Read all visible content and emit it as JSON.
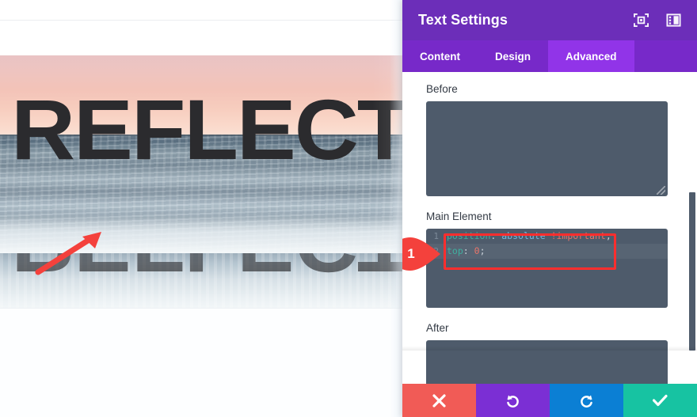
{
  "preview": {
    "hero_title": "REFLECTIO",
    "reflection_title": "REFLECTIO",
    "annotation_arrow": "red-arrow-pointing-at-reflection"
  },
  "modal": {
    "title": "Text Settings",
    "header_icons": [
      {
        "name": "focus-mode-icon",
        "glyph": "target-frame"
      },
      {
        "name": "layout-panel-icon",
        "glyph": "panel-columns"
      }
    ],
    "tabs": [
      {
        "label": "Content",
        "active": false
      },
      {
        "label": "Design",
        "active": false
      },
      {
        "label": "Advanced",
        "active": true
      }
    ],
    "fields": {
      "before": {
        "label": "Before",
        "value": "",
        "placeholder": ""
      },
      "main_element": {
        "label": "Main Element"
      },
      "after": {
        "label": "After",
        "value": "",
        "placeholder": ""
      }
    },
    "code_editor": {
      "lines": [
        {
          "number": "1",
          "tokens": [
            {
              "text": "position",
              "type": "prop"
            },
            {
              "text": ": ",
              "type": "punc"
            },
            {
              "text": "absolute",
              "type": "val"
            },
            {
              "text": " ",
              "type": "punc"
            },
            {
              "text": "!important",
              "type": "imp"
            },
            {
              "text": ";",
              "type": "punc"
            }
          ],
          "plain": "position: absolute !important;",
          "active": false
        },
        {
          "number": "2",
          "tokens": [
            {
              "text": "top",
              "type": "prop"
            },
            {
              "text": ": ",
              "type": "punc"
            },
            {
              "text": "0",
              "type": "num"
            },
            {
              "text": ";",
              "type": "punc"
            }
          ],
          "plain": "top: 0;",
          "active": true
        }
      ]
    },
    "callout": {
      "number": "1"
    },
    "footer_buttons": [
      {
        "name": "cancel-button",
        "icon": "close-x-icon",
        "color": "#f15b56"
      },
      {
        "name": "undo-button",
        "icon": "undo-arrow-icon",
        "color": "#7b2fd4"
      },
      {
        "name": "redo-button",
        "icon": "redo-arrow-icon",
        "color": "#0b7fd4"
      },
      {
        "name": "save-button",
        "icon": "checkmark-icon",
        "color": "#17c3a2"
      }
    ]
  },
  "colors": {
    "header_purple": "#6c2eb9",
    "tabbar_purple": "#7729c9",
    "active_tab_purple": "#9134e8",
    "input_slate": "#4e5b6b",
    "highlight_red": "#ff2e2e",
    "callout_red": "#f4413c"
  }
}
